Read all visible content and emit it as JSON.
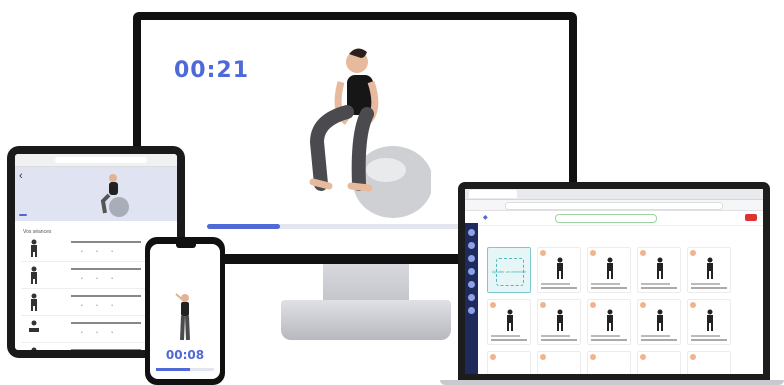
{
  "monitor": {
    "timer": "00:21",
    "progress": 0.25
  },
  "tablet": {
    "section_heading": "Vos séances"
  },
  "phone": {
    "timer": "00:08",
    "progress": 0.58
  },
  "laptop": {
    "grid_columns": 5,
    "grid_rows": 3,
    "selected_card_text": "Ajouter un exercice"
  },
  "colors": {
    "accent": "#4f69d6",
    "sidebar": "#1f2a5c",
    "question": "#e0763a",
    "selected": "#4fb8c0"
  },
  "icons": {
    "tablet_back": "chevron-left-icon",
    "monitor_person": "woman-on-ball-icon"
  }
}
